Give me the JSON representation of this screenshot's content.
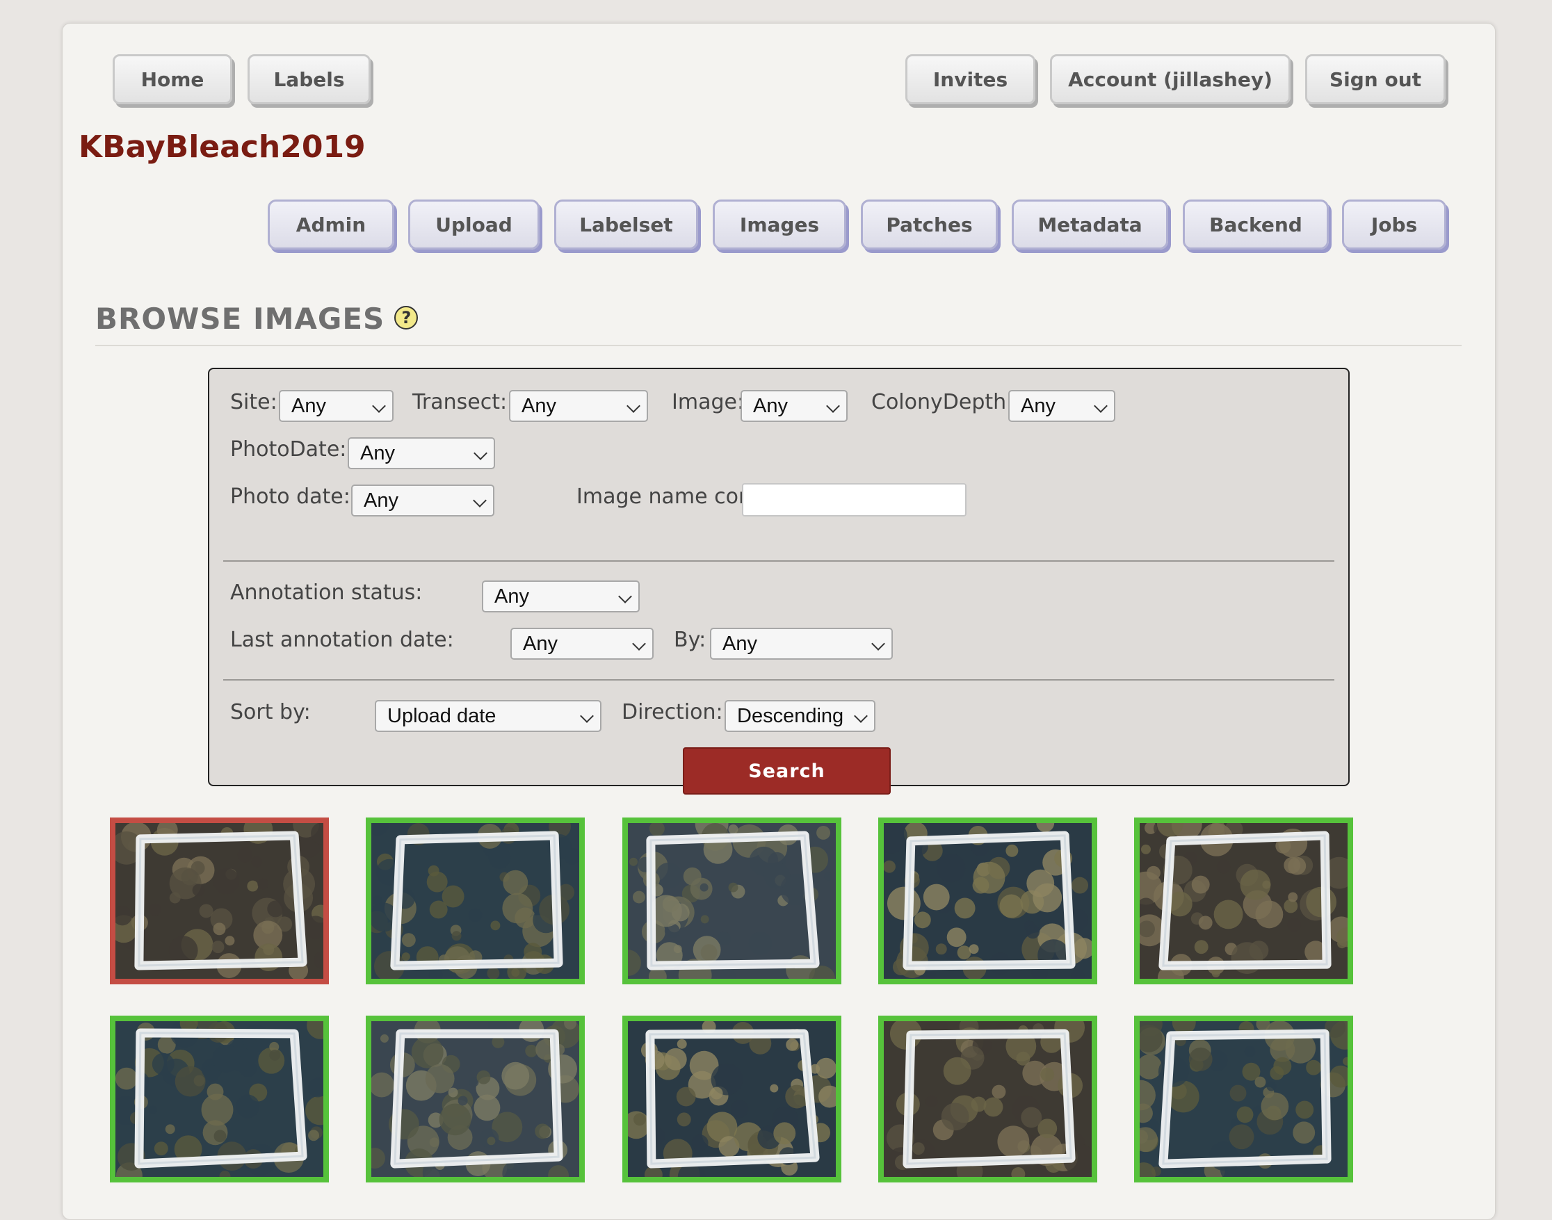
{
  "top_nav": {
    "home": "Home",
    "labels": "Labels",
    "invites": "Invites",
    "account": "Account (jillashey)",
    "sign_out": "Sign out"
  },
  "source": {
    "title": "KBayBleach2019"
  },
  "source_nav": [
    "Admin",
    "Upload",
    "Labelset",
    "Images",
    "Patches",
    "Metadata",
    "Backend",
    "Jobs"
  ],
  "page": {
    "heading": "BROWSE IMAGES",
    "help_icon": "?"
  },
  "filters": {
    "site": {
      "label": "Site:",
      "value": "Any"
    },
    "transect": {
      "label": "Transect:",
      "value": "Any"
    },
    "image": {
      "label": "Image:",
      "value": "Any"
    },
    "colony_depth": {
      "label": "ColonyDepth:",
      "value": "Any"
    },
    "photo_date_meta": {
      "label": "PhotoDate:",
      "value": "Any"
    },
    "photo_date": {
      "label": "Photo date:",
      "value": "Any"
    },
    "image_name": {
      "label": "Image name contains:",
      "value": ""
    },
    "annotation_status": {
      "label": "Annotation status:",
      "value": "Any"
    },
    "last_annotation_date": {
      "label": "Last annotation date:",
      "value": "Any"
    },
    "by": {
      "label": "By:",
      "value": "Any"
    },
    "sort_by": {
      "label": "Sort by:",
      "value": "Upload date"
    },
    "direction": {
      "label": "Direction:",
      "value": "Descending"
    },
    "search_button": "Search"
  },
  "colors": {
    "confirmed_border": "#56c23b",
    "unannotated_border": "#c44d44",
    "source_title": "#7a1c12",
    "search_button": "#9c2b26"
  },
  "thumbnails": [
    {
      "status": "unannotated"
    },
    {
      "status": "confirmed"
    },
    {
      "status": "confirmed"
    },
    {
      "status": "confirmed"
    },
    {
      "status": "confirmed"
    },
    {
      "status": "confirmed"
    },
    {
      "status": "confirmed"
    },
    {
      "status": "confirmed"
    },
    {
      "status": "confirmed"
    },
    {
      "status": "confirmed"
    }
  ]
}
